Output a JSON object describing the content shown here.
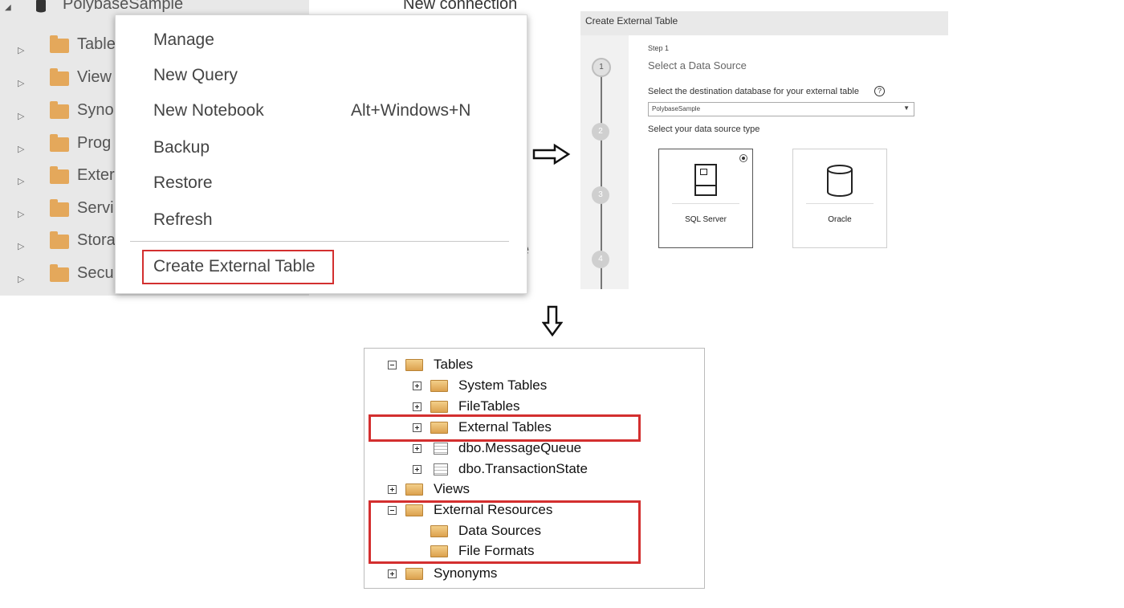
{
  "ads": {
    "database": "PolybaseSample",
    "tree_items": [
      {
        "label": "Table"
      },
      {
        "label": "View"
      },
      {
        "label": "Syno"
      },
      {
        "label": "Prog"
      },
      {
        "label": "Exter"
      },
      {
        "label": "Servi"
      },
      {
        "label": "Stora"
      },
      {
        "label": "Secu"
      }
    ],
    "behind_text": "New connection",
    "behind_fragment": "e"
  },
  "context_menu": {
    "items": [
      {
        "label": "Manage",
        "shortcut": ""
      },
      {
        "label": "New Query",
        "shortcut": ""
      },
      {
        "label": "New Notebook",
        "shortcut": "Alt+Windows+N"
      },
      {
        "label": "Backup",
        "shortcut": ""
      },
      {
        "label": "Restore",
        "shortcut": ""
      },
      {
        "label": "Refresh",
        "shortcut": ""
      }
    ],
    "highlighted_item": "Create External Table",
    "highlight_color": "#d32f2f"
  },
  "wizard": {
    "title": "Create External Table",
    "steps": [
      "1",
      "2",
      "3",
      "4"
    ],
    "active_step": 1,
    "step_label": "Step 1",
    "heading": "Select a Data Source",
    "destination_label": "Select the destination database for your external table",
    "help_icon": "?",
    "destination_value": "PolybaseSample",
    "data_source_label": "Select your data source type",
    "data_sources": [
      {
        "name": "SQL Server",
        "icon": "sql-server-icon",
        "selected": true
      },
      {
        "name": "Oracle",
        "icon": "database-cylinder-icon",
        "selected": false
      }
    ]
  },
  "ssms": {
    "tables": "Tables",
    "system_tables": "System Tables",
    "file_tables": "FileTables",
    "external_tables": "External Tables",
    "message_queue": "dbo.MessageQueue",
    "transaction_state": "dbo.TransactionState",
    "views": "Views",
    "external_resources": "External Resources",
    "data_sources": "Data Sources",
    "file_formats": "File Formats",
    "synonyms": "Synonyms"
  }
}
